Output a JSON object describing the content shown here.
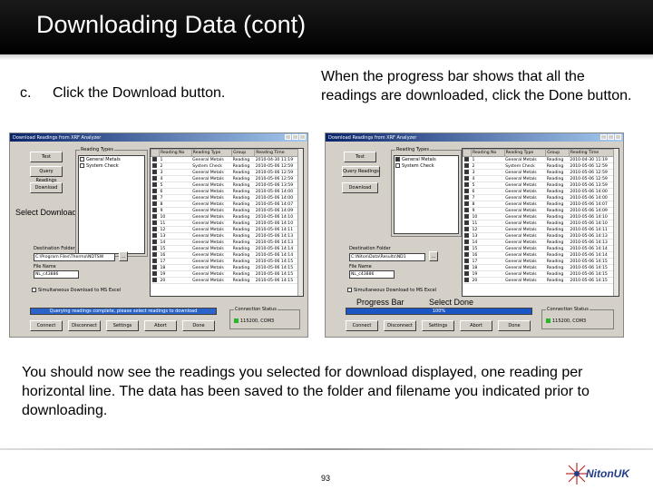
{
  "slide": {
    "title": "Downloading Data (cont)",
    "step_letter": "c.",
    "step_text": "Click the Download button.",
    "right_note": "When the progress bar shows that all the readings are downloaded, click the Done button.",
    "body": "You should now see the readings you selected for download displayed, one reading per horizontal line. The data has been saved to the folder and filename you indicated prior to downloading.",
    "page_number": "93",
    "logo_text": "NitonUK"
  },
  "left_shot": {
    "window_title": "Download Readings from XRF Analyzer",
    "buttons": {
      "test": "Test",
      "query": "Query Readings",
      "download": "Download"
    },
    "annotation": "Select Download",
    "reading_types_label": "Reading Types",
    "reading_types": [
      {
        "label": "General Metals",
        "checked": false
      },
      {
        "label": "System Check",
        "checked": false
      }
    ],
    "columns": [
      "Reading No",
      "Reading Type",
      "Group",
      "Reading Time"
    ],
    "rows": [
      [
        "1",
        "General Metals",
        "Reading",
        "2010-04-30 11:19"
      ],
      [
        "2",
        "System Check",
        "Reading",
        "2010-05-06 12:59"
      ],
      [
        "3",
        "General Metals",
        "Reading",
        "2010-05-06 12:59"
      ],
      [
        "4",
        "General Metals",
        "Reading",
        "2010-05-06 12:59"
      ],
      [
        "5",
        "General Metals",
        "Reading",
        "2010-05-06 13:59"
      ],
      [
        "6",
        "General Metals",
        "Reading",
        "2010-05-06 14:00"
      ],
      [
        "7",
        "General Metals",
        "Reading",
        "2010-05-06 14:00"
      ],
      [
        "8",
        "General Metals",
        "Reading",
        "2010-05-06 14:07"
      ],
      [
        "9",
        "General Metals",
        "Reading",
        "2010-05-06 14:09"
      ],
      [
        "10",
        "General Metals",
        "Reading",
        "2010-05-06 14:10"
      ],
      [
        "11",
        "General Metals",
        "Reading",
        "2010-05-06 14:10"
      ],
      [
        "12",
        "General Metals",
        "Reading",
        "2010-05-06 14:11"
      ],
      [
        "13",
        "General Metals",
        "Reading",
        "2010-05-06 14:13"
      ],
      [
        "14",
        "General Metals",
        "Reading",
        "2010-05-06 14:13"
      ],
      [
        "15",
        "General Metals",
        "Reading",
        "2010-05-06 14:14"
      ],
      [
        "16",
        "General Metals",
        "Reading",
        "2010-05-06 14:14"
      ],
      [
        "17",
        "General Metals",
        "Reading",
        "2010-05-06 14:15"
      ],
      [
        "18",
        "General Metals",
        "Reading",
        "2010-05-06 14:15"
      ],
      [
        "19",
        "General Metals",
        "Reading",
        "2010-05-06 14:15"
      ],
      [
        "20",
        "General Metals",
        "Reading",
        "2010-05-06 14:15"
      ]
    ],
    "dest_folder_label": "Destination Folder",
    "dest_folder_value": "C:\\Program Files\\Thermo\\NDTSW",
    "file_name_label": "File Name",
    "file_name_value": "NL_c43886",
    "simul_label": "Simultaneous Download to MS Excel",
    "status_message": "Querying readings complete, please select readings to download",
    "bottom_buttons": [
      "Connect",
      "Disconnect",
      "Settings",
      "Abort",
      "Done"
    ],
    "conn_status_label": "Connection Status",
    "conn_status_value": "115200, COM3"
  },
  "right_shot": {
    "window_title": "Download Readings from XRF Analyzer",
    "buttons": {
      "test": "Test",
      "query": "Query Readings",
      "download": "Download"
    },
    "reading_types_label": "Reading Types",
    "reading_types": [
      {
        "label": "General Metals",
        "checked": true
      },
      {
        "label": "System Check",
        "checked": false
      }
    ],
    "columns": [
      "Reading No",
      "Reading Type",
      "Group",
      "Reading Time"
    ],
    "rows": [
      [
        "1",
        "General Metals",
        "Reading",
        "2010-04-30 11:19"
      ],
      [
        "2",
        "System Check",
        "Reading",
        "2010-05-06 12:59"
      ],
      [
        "3",
        "General Metals",
        "Reading",
        "2010-05-06 12:59"
      ],
      [
        "4",
        "General Metals",
        "Reading",
        "2010-05-06 12:59"
      ],
      [
        "5",
        "General Metals",
        "Reading",
        "2010-05-06 13:59"
      ],
      [
        "6",
        "General Metals",
        "Reading",
        "2010-05-06 14:00"
      ],
      [
        "7",
        "General Metals",
        "Reading",
        "2010-05-06 14:00"
      ],
      [
        "8",
        "General Metals",
        "Reading",
        "2010-05-06 14:07"
      ],
      [
        "9",
        "General Metals",
        "Reading",
        "2010-05-06 14:09"
      ],
      [
        "10",
        "General Metals",
        "Reading",
        "2010-05-06 14:10"
      ],
      [
        "11",
        "General Metals",
        "Reading",
        "2010-05-06 14:10"
      ],
      [
        "12",
        "General Metals",
        "Reading",
        "2010-05-06 14:11"
      ],
      [
        "13",
        "General Metals",
        "Reading",
        "2010-05-06 14:13"
      ],
      [
        "14",
        "General Metals",
        "Reading",
        "2010-05-06 14:13"
      ],
      [
        "15",
        "General Metals",
        "Reading",
        "2010-05-06 14:14"
      ],
      [
        "16",
        "General Metals",
        "Reading",
        "2010-05-06 14:14"
      ],
      [
        "17",
        "General Metals",
        "Reading",
        "2010-05-06 14:15"
      ],
      [
        "18",
        "General Metals",
        "Reading",
        "2010-05-06 14:15"
      ],
      [
        "19",
        "General Metals",
        "Reading",
        "2010-05-06 14:15"
      ],
      [
        "20",
        "General Metals",
        "Reading",
        "2010-05-06 14:15"
      ]
    ],
    "dest_folder_label": "Destination Folder",
    "dest_folder_value": "C:\\Niton\\Data\\Results\\ND1",
    "file_name_label": "File Name",
    "file_name_value": "NL_c43886",
    "simul_label": "Simultaneous Download to MS Excel",
    "annotation_progress": "Progress Bar",
    "annotation_done": "Select Done",
    "progress_text": "100%",
    "progress_value": 1.0,
    "bottom_buttons": [
      "Connect",
      "Disconnect",
      "Settings",
      "Abort",
      "Done"
    ],
    "conn_status_label": "Connection Status",
    "conn_status_value": "115200, COM3"
  },
  "colors": {
    "title_bg": "#000000",
    "progress": "#1a56c4",
    "lamp": "#2bb52b",
    "logo": "#1f3c88"
  }
}
